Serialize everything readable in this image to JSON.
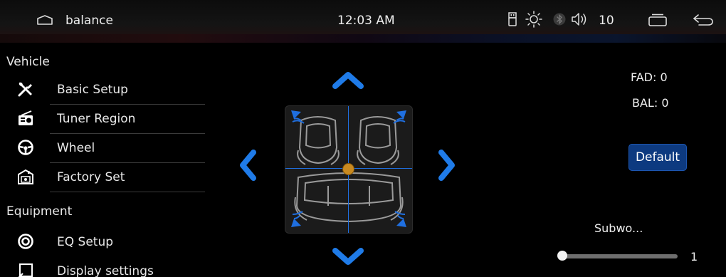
{
  "status_bar": {
    "title": "balance",
    "time": "12:03 AM",
    "volume": "10",
    "icons": [
      "home-icon",
      "usb-icon",
      "brightness-icon",
      "bluetooth-icon",
      "volume-icon",
      "recent-apps-icon",
      "back-icon"
    ]
  },
  "sidebar": {
    "sections": [
      {
        "header": "Vehicle",
        "items": [
          {
            "label": "Basic Setup",
            "icon": "wrench-screwdriver-icon"
          },
          {
            "label": "Tuner Region",
            "icon": "radio-icon"
          },
          {
            "label": "Wheel",
            "icon": "steering-wheel-icon"
          },
          {
            "label": "Factory Set",
            "icon": "factory-icon"
          }
        ]
      },
      {
        "header": "Equipment",
        "items": [
          {
            "label": "EQ Setup",
            "icon": "speaker-icon"
          },
          {
            "label": "Display settings",
            "icon": "display-icon"
          }
        ]
      }
    ]
  },
  "balance": {
    "fad_label": "FAD: 0",
    "bal_label": "BAL: 0",
    "fad_value": 0,
    "bal_value": 0,
    "default_button": "Default"
  },
  "subwoofer": {
    "label": "Subwo...",
    "value_text": "1",
    "level_fraction": 0.03
  },
  "colors": {
    "accent_blue": "#1f7be8",
    "button_blue": "#0d3a80",
    "knob_orange": "#c98a20",
    "background": "#000000"
  }
}
